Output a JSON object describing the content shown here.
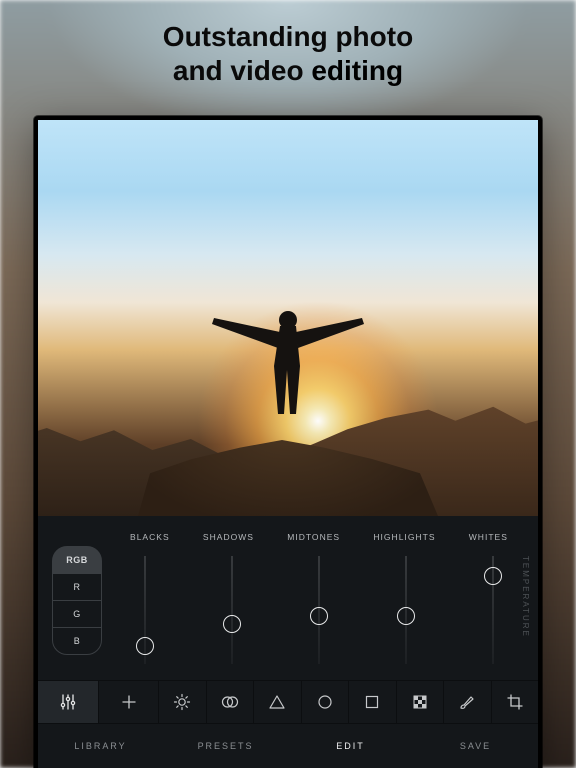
{
  "headline": {
    "line1": "Outstanding photo",
    "line2_prefix": "and video ",
    "line2_highlight": "editing"
  },
  "channels": [
    "RGB",
    "R",
    "G",
    "B"
  ],
  "active_channel": "RGB",
  "tone_labels": [
    "BLACKS",
    "SHADOWS",
    "MIDTONES",
    "HIGHLIGHTS",
    "WHITES"
  ],
  "slider_positions_pct": [
    80,
    62,
    55,
    55,
    22
  ],
  "side_label": "TEMPERATURE",
  "tool_icons": [
    "levels",
    "add",
    "sun",
    "overlap",
    "triangle",
    "circle",
    "square",
    "checker",
    "brush",
    "crop"
  ],
  "active_tool": "levels",
  "bottom_tabs": [
    "LIBRARY",
    "PRESETS",
    "EDIT",
    "SAVE"
  ],
  "active_bottom_tab": "EDIT"
}
